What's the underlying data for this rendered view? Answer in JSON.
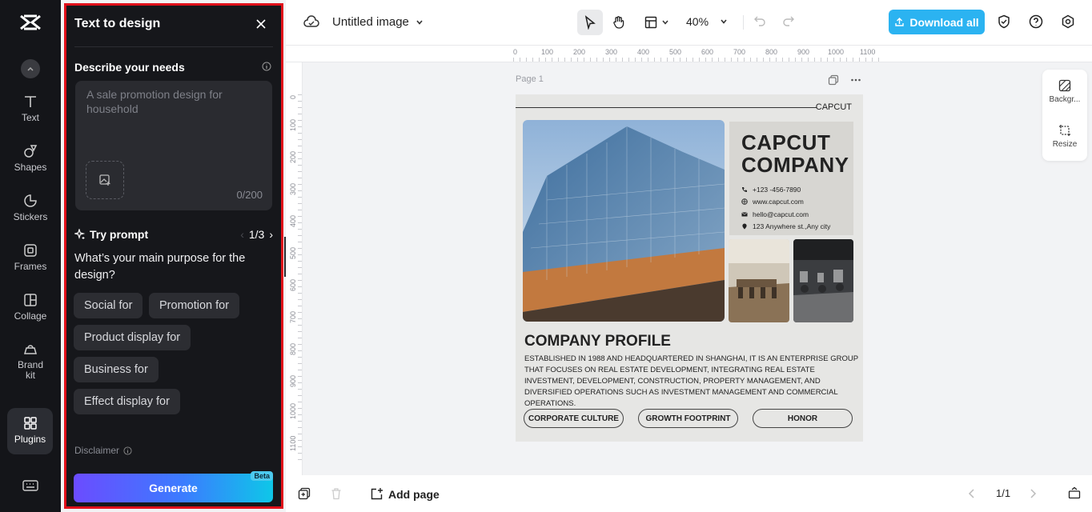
{
  "rail": {
    "items": [
      {
        "label": "Text",
        "icon": "text-icon"
      },
      {
        "label": "Shapes",
        "icon": "shapes-icon"
      },
      {
        "label": "Stickers",
        "icon": "stickers-icon"
      },
      {
        "label": "Frames",
        "icon": "frames-icon"
      },
      {
        "label": "Collage",
        "icon": "collage-icon"
      },
      {
        "label": "Brand kit",
        "icon": "brand-kit-icon"
      },
      {
        "label": "Plugins",
        "icon": "plugins-icon"
      }
    ]
  },
  "panel": {
    "title": "Text to design",
    "describe_label": "Describe your needs",
    "prompt_placeholder": "A sale promotion design for household",
    "char_counter": "0/200",
    "try_prompt_label": "Try prompt",
    "pager": "1/3",
    "question": "What’s your main purpose for the design?",
    "chips": [
      "Social for",
      "Promotion for",
      "Product display for",
      "Business for",
      "Effect display for"
    ],
    "disclaimer": "Disclaimer",
    "generate_label": "Generate",
    "beta_badge": "Beta",
    "accent": "#e0101a"
  },
  "topbar": {
    "doc_title": "Untitled image",
    "zoom": "40%",
    "download_label": "Download all",
    "download_color": "#2bb3f1"
  },
  "rulers": {
    "top": [
      "0",
      "100",
      "200",
      "300",
      "400",
      "500",
      "600",
      "700",
      "800",
      "900",
      "1000",
      "1100"
    ],
    "left": [
      "0",
      "100",
      "200",
      "300",
      "400",
      "500",
      "600",
      "700",
      "800",
      "900",
      "1000",
      "1100"
    ]
  },
  "canvas": {
    "page_label": "Page 1",
    "design": {
      "brand": "CAPCUT",
      "company_name_line1": "CAPCUT",
      "company_name_line2": "COMPANY",
      "phone": "+123 -456-7890",
      "website": "www.capcut.com",
      "email": "hello@capcut.com",
      "address": "123 Anywhere st.,Any city",
      "profile_heading": "COMPANY PROFILE",
      "profile_text": "ESTABLISHED IN 1988 AND HEADQUARTERED IN SHANGHAI, IT IS AN ENTERPRISE GROUP THAT FOCUSES ON REAL ESTATE DEVELOPMENT, INTEGRATING REAL ESTATE INVESTMENT, DEVELOPMENT, CONSTRUCTION, PROPERTY MANAGEMENT, AND DIVERSIFIED OPERATIONS SUCH AS INVESTMENT MANAGEMENT AND COMMERCIAL OPERATIONS.",
      "buttons": [
        "CORPORATE CULTURE",
        "GROWTH FOOTPRINT",
        "HONOR"
      ]
    }
  },
  "float_panel": {
    "background_label": "Backgr...",
    "resize_label": "Resize"
  },
  "bottombar": {
    "add_page_label": "Add page",
    "page_indicator": "1/1"
  }
}
